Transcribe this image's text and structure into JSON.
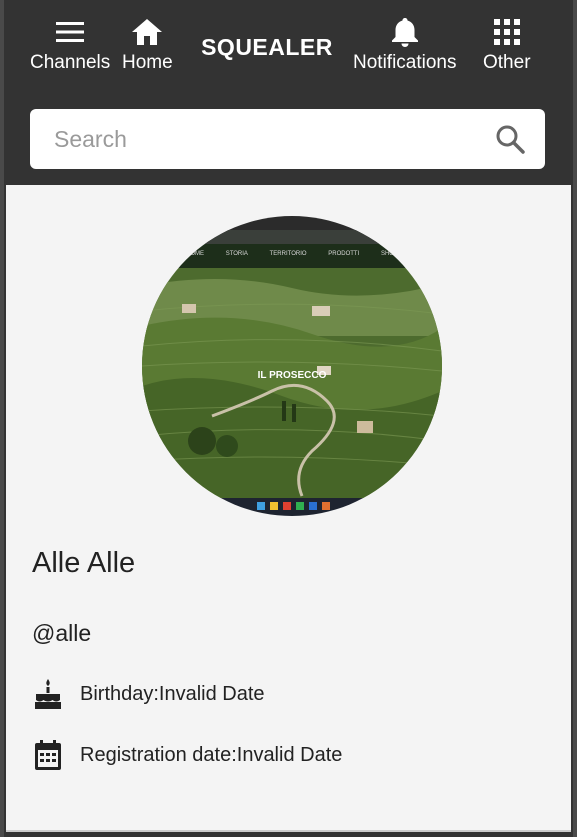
{
  "header": {
    "nav_left": [
      {
        "id": "channels",
        "label": "Channels",
        "icon": "menu-icon"
      },
      {
        "id": "home",
        "label": "Home",
        "icon": "home-icon"
      }
    ],
    "brand": "SQUEALER",
    "nav_right": [
      {
        "id": "notifications",
        "label": "Notifications",
        "icon": "bell-icon"
      },
      {
        "id": "other",
        "label": "Other",
        "icon": "apps-grid-icon"
      }
    ]
  },
  "search": {
    "placeholder": "Search",
    "value": ""
  },
  "profile": {
    "avatar_caption": "IL PROSECCO",
    "avatar_menu": [
      "HOME",
      "STORIA",
      "TERRITORIO",
      "PRODOTTI",
      "SHOP"
    ],
    "name": "Alle Alle",
    "handle": "@alle",
    "birthday": "Birthday:Invalid Date",
    "registration": "Registration date:Invalid Date"
  },
  "colors": {
    "header_bg": "#333333",
    "card_bg": "#f4f4f4",
    "text": "#222222"
  }
}
